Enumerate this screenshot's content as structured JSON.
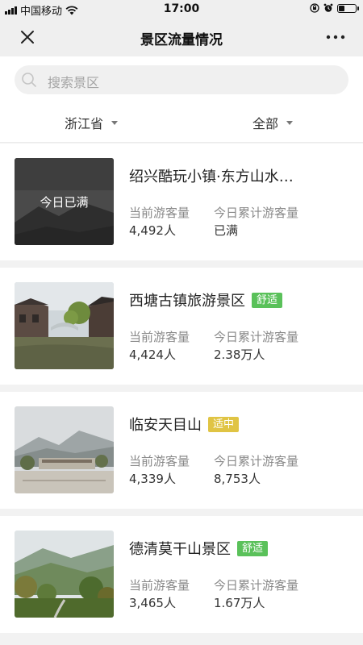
{
  "status_bar": {
    "carrier": "中国移动",
    "time": "17:00"
  },
  "nav": {
    "title": "景区流量情况",
    "close_icon": "close-icon",
    "more_icon": "more-dots-icon"
  },
  "search": {
    "placeholder": "搜索景区"
  },
  "filters": {
    "province": "浙江省",
    "range": "全部"
  },
  "colors": {
    "comfortable": "#5ac15a",
    "moderate": "#e0c444"
  },
  "scenic_spots": [
    {
      "name": "绍兴酷玩小镇·东方山水…",
      "overlay": "今日已满",
      "badge": "",
      "current_label": "当前游客量",
      "current_value": "4,492人",
      "today_label": "今日累计游客量",
      "today_value": "已满"
    },
    {
      "name": "西塘古镇旅游景区",
      "badge": "舒适",
      "badge_color": "#5ac15a",
      "current_label": "当前游客量",
      "current_value": "4,424人",
      "today_label": "今日累计游客量",
      "today_value": "2.38万人"
    },
    {
      "name": "临安天目山",
      "badge": "适中",
      "badge_color": "#e0c444",
      "current_label": "当前游客量",
      "current_value": "4,339人",
      "today_label": "今日累计游客量",
      "today_value": "8,753人"
    },
    {
      "name": "德清莫干山景区",
      "badge": "舒适",
      "badge_color": "#5ac15a",
      "current_label": "当前游客量",
      "current_value": "3,465人",
      "today_label": "今日累计游客量",
      "today_value": "1.67万人"
    }
  ]
}
